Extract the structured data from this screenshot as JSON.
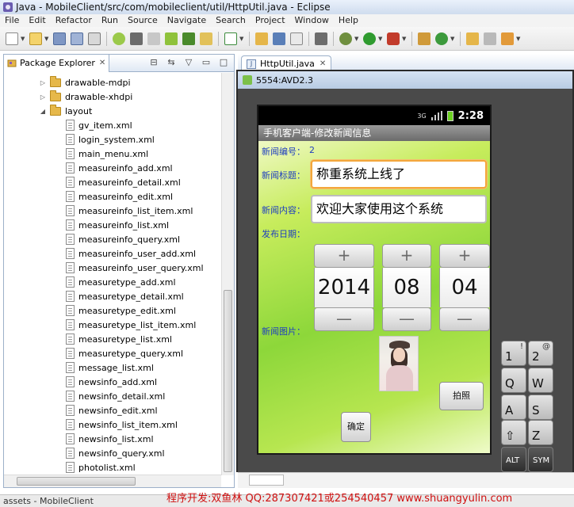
{
  "window": {
    "title": "Java - MobileClient/src/com/mobileclient/util/HttpUtil.java - Eclipse"
  },
  "menubar": [
    "File",
    "Edit",
    "Refactor",
    "Run",
    "Source",
    "Navigate",
    "Search",
    "Project",
    "Window",
    "Help"
  ],
  "package_explorer": {
    "tab_label": "Package Explorer",
    "tab_close": "✕",
    "items": [
      {
        "label": "drawable-mdpi",
        "type": "folder",
        "expanded": false
      },
      {
        "label": "drawable-xhdpi",
        "type": "folder",
        "expanded": false
      },
      {
        "label": "layout",
        "type": "folder",
        "expanded": true
      },
      {
        "label": "gv_item.xml",
        "type": "file"
      },
      {
        "label": "login_system.xml",
        "type": "file"
      },
      {
        "label": "main_menu.xml",
        "type": "file"
      },
      {
        "label": "measureinfo_add.xml",
        "type": "file"
      },
      {
        "label": "measureinfo_detail.xml",
        "type": "file"
      },
      {
        "label": "measureinfo_edit.xml",
        "type": "file"
      },
      {
        "label": "measureinfo_list_item.xml",
        "type": "file"
      },
      {
        "label": "measureinfo_list.xml",
        "type": "file"
      },
      {
        "label": "measureinfo_query.xml",
        "type": "file"
      },
      {
        "label": "measureinfo_user_add.xml",
        "type": "file"
      },
      {
        "label": "measureinfo_user_query.xml",
        "type": "file"
      },
      {
        "label": "measuretype_add.xml",
        "type": "file"
      },
      {
        "label": "measuretype_detail.xml",
        "type": "file"
      },
      {
        "label": "measuretype_edit.xml",
        "type": "file"
      },
      {
        "label": "measuretype_list_item.xml",
        "type": "file"
      },
      {
        "label": "measuretype_list.xml",
        "type": "file"
      },
      {
        "label": "measuretype_query.xml",
        "type": "file"
      },
      {
        "label": "message_list.xml",
        "type": "file"
      },
      {
        "label": "newsinfo_add.xml",
        "type": "file"
      },
      {
        "label": "newsinfo_detail.xml",
        "type": "file"
      },
      {
        "label": "newsinfo_edit.xml",
        "type": "file"
      },
      {
        "label": "newsinfo_list_item.xml",
        "type": "file"
      },
      {
        "label": "newsinfo_list.xml",
        "type": "file"
      },
      {
        "label": "newsinfo_query.xml",
        "type": "file"
      },
      {
        "label": "photolist.xml",
        "type": "file"
      }
    ]
  },
  "editor": {
    "tab_label": "HttpUtil.java",
    "tab_close": "✕"
  },
  "emulator": {
    "title": "5554:AVD2.3",
    "status_time": "2:28",
    "network_label": "3G",
    "app": {
      "title": "手机客户端-修改新闻信息",
      "news_id_label": "新闻编号：",
      "news_id_value": "2",
      "news_title_label": "新闻标题：",
      "news_title_value": "称重系统上线了",
      "news_content_label": "新闻内容：",
      "news_content_value": "欢迎大家使用这个系统",
      "publish_date_label": "发布日期：",
      "date_year": "2014",
      "date_month": "08",
      "date_day": "04",
      "plus": "+",
      "minus": "—",
      "news_image_label": "新闻图片：",
      "take_photo_button": "拍照",
      "confirm_button": "确定"
    },
    "keyboard": [
      {
        "main": "1",
        "alt": "!"
      },
      {
        "main": "2",
        "alt": "@"
      },
      {
        "main": "Q",
        "alt": ""
      },
      {
        "main": "W",
        "alt": ""
      },
      {
        "main": "A",
        "alt": ""
      },
      {
        "main": "S",
        "alt": ""
      },
      {
        "main": "⇧",
        "alt": ""
      },
      {
        "main": "Z",
        "alt": ""
      },
      {
        "main": "ALT",
        "alt": ""
      },
      {
        "main": "SYM",
        "alt": ""
      }
    ]
  },
  "statusbar": {
    "text": "assets - MobileClient"
  },
  "credit": "程序开发:双鱼林 QQ:287307421或254540457 www.shuangyulin.com",
  "colors": {
    "app_label": "#1f3fbf",
    "focus_border": "#f3a73b",
    "credit": "#d01010"
  }
}
